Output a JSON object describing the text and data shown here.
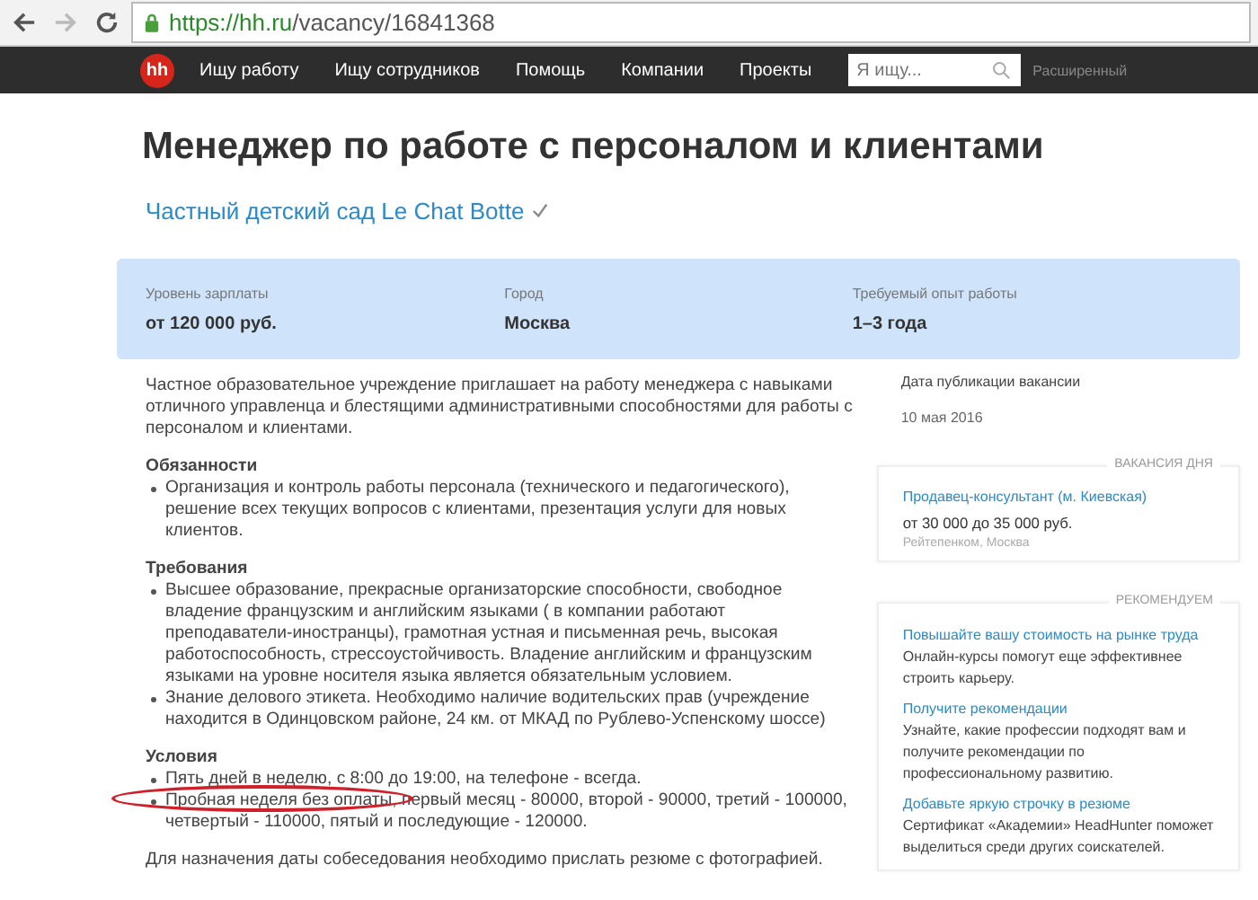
{
  "browser": {
    "url_host": "https://hh.ru",
    "url_path": "/vacancy/16841368"
  },
  "nav": {
    "logo": "hh",
    "items": [
      "Ищу работу",
      "Ищу сотрудников",
      "Помощь",
      "Компании",
      "Проекты"
    ],
    "search": {
      "placeholder": "Я ищу..."
    },
    "advanced": "Расширенный"
  },
  "vacancy": {
    "title": "Менеджер по работе с персоналом и клиентами",
    "company": "Частный детский сад Le Chat Botte",
    "verified": true
  },
  "summary": [
    {
      "label": "Уровень зарплаты",
      "value": "от 120 000 руб."
    },
    {
      "label": "Город",
      "value": "Москва"
    },
    {
      "label": "Требуемый опыт работы",
      "value": "1–3 года"
    }
  ],
  "description": {
    "intro": "Частное образовательное учреждение приглашает на работу менеджера с навыками отличного управленца и блестящими административными способностями для работы с персоналом и клиентами.",
    "sections": [
      {
        "heading": "Обязанности",
        "items": [
          {
            "text": "Организация и контроль работы персонала (технического и педагогического), решение всех текущих вопросов с клиентами, презентация услуги для новых клиентов.",
            "circled": false
          }
        ]
      },
      {
        "heading": "Требования",
        "items": [
          {
            "text": "Высшее образование, прекрасные организаторские способности, свободное владение французским и английским языками ( в компании работают преподаватели-иностранцы), грамотная устная и письменная речь, высокая работоспособность, стрессоустойчивость. Владение английским и французским языками на уровне носителя языка является обязательным условием.",
            "circled": false
          },
          {
            "text": "Знание делового этикета. Необходимо наличие водительских прав (учреждение находится в Одинцовском районе, 24 км. от МКАД по Рублево-Успенскому шоссе)",
            "circled": false
          }
        ]
      },
      {
        "heading": "Условия",
        "items": [
          {
            "text": "Пять дней в неделю, с 8:00 до 19:00, на телефоне - всегда.",
            "circled": false
          },
          {
            "text": "Пробная неделя без оплаты, первый месяц - 80000, второй - 90000, третий - 100000, четвертый - 110000, пятый и последующие - 120000.",
            "circled": true
          }
        ]
      }
    ],
    "outro": "Для назначения даты собеседования необходимо прислать резюме с фотографией."
  },
  "sidebar": {
    "date_label": "Дата публикации вакансии",
    "date": "10 мая 2016",
    "vacancy_of_day": {
      "legend": "ВАКАНСИЯ ДНЯ",
      "title": "Продавец-консультант (м. Киевская)",
      "salary": "от 30 000 до 35 000 руб.",
      "employer": "Рейтепенком, Москва"
    },
    "recommend": {
      "legend": "РЕКОМЕНДУЕМ",
      "items": [
        {
          "title": "Повышайте вашу стоимость на рынке труда",
          "text": "Онлайн-курсы помогут еще эффективнее строить карьеру."
        },
        {
          "title": "Получите рекомендации",
          "text": "Узнайте, какие профессии подходят вам и получите рекомендации по профессиональному развитию."
        },
        {
          "title": "Добавьте яркую строчку в резюме",
          "text": "Сертификат «Академии» HeadHunter поможет выделиться среди других соискателей."
        }
      ]
    }
  }
}
